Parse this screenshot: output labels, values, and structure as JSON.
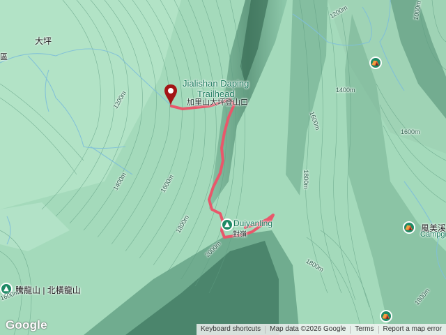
{
  "map": {
    "route_color": "#e8586b",
    "terrain_color": "#9fd6b7",
    "ridge_color": "#3f7c63",
    "labels": {
      "trailhead_en": [
        "Jialishan Daping",
        "Trailhead"
      ],
      "trailhead_cn": "加里山大坪登山口",
      "daping": "大坪",
      "district_fragment": "區",
      "duiyan": "Duiyanling",
      "duiyan_cn": "對嶺",
      "fengmei": "風美溪",
      "fengmei_sub": "Campgr",
      "tenglong": "騰龍山 | 北橫龍山"
    },
    "contours": [
      "1200m",
      "1400m",
      "1600m",
      "1800m",
      "2000m",
      "1200m",
      "1400m",
      "1600m",
      "1600m",
      "1800m",
      "1800m",
      "1000m",
      "1800m",
      "1600m"
    ]
  },
  "branding": {
    "logo": "Google"
  },
  "footer": {
    "shortcuts": "Keyboard shortcuts",
    "map_data": "Map data ©2026 Google",
    "terms": "Terms",
    "report": "Report a map error"
  }
}
